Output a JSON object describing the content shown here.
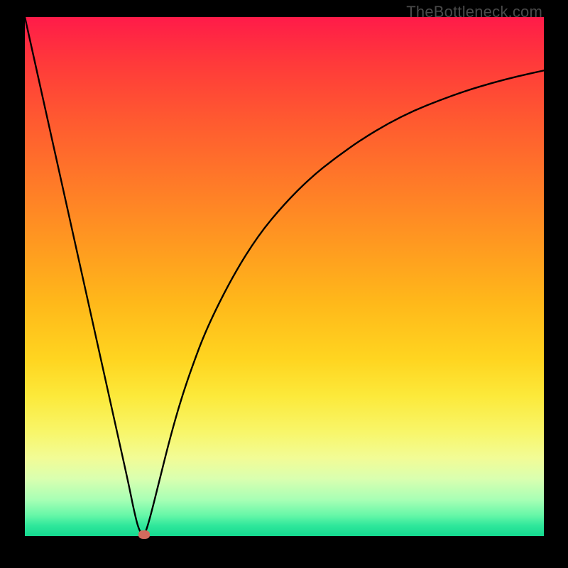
{
  "watermark": "TheBottleneck.com",
  "chart_data": {
    "type": "line",
    "title": "",
    "xlabel": "",
    "ylabel": "",
    "xlim": [
      0,
      100
    ],
    "ylim": [
      0,
      100
    ],
    "background_gradient": {
      "top_color": "#ff1b49",
      "bottom_color": "#14d98f",
      "description": "vertical red-to-green gradient indicating bottleneck severity (red=high, green=low)"
    },
    "series": [
      {
        "name": "bottleneck-curve",
        "color": "#000000",
        "x": [
          0,
          2,
          4,
          6,
          8,
          10,
          12,
          14,
          16,
          18,
          20,
          21,
          22,
          23,
          24,
          26,
          28,
          30,
          32,
          35,
          40,
          45,
          50,
          55,
          60,
          65,
          70,
          75,
          80,
          85,
          90,
          95,
          100
        ],
        "y": [
          100,
          91,
          82,
          73,
          64,
          55,
          46,
          37,
          28,
          19,
          10,
          5,
          1,
          0,
          3,
          11,
          19,
          26,
          32,
          40,
          50,
          58,
          64,
          69,
          73,
          76.5,
          79.5,
          82,
          84,
          85.8,
          87.3,
          88.6,
          89.7
        ]
      }
    ],
    "marker": {
      "name": "optimal-point",
      "x": 23,
      "y": 0,
      "color": "#d36a5d"
    }
  }
}
